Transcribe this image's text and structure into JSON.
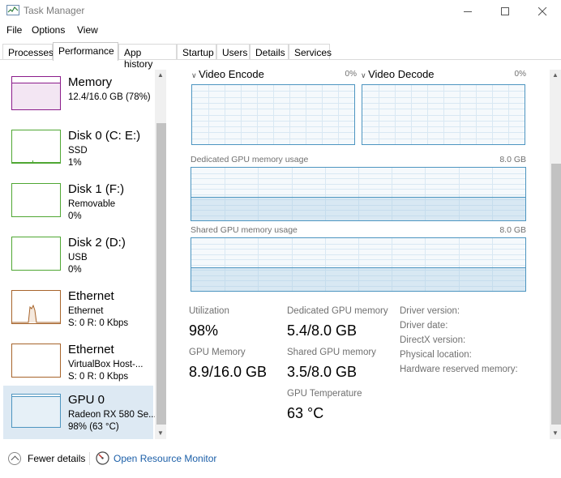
{
  "window": {
    "title": "Task Manager"
  },
  "menu": [
    "File",
    "Options",
    "View"
  ],
  "tabs": [
    "Processes",
    "Performance",
    "App history",
    "Startup",
    "Users",
    "Details",
    "Services"
  ],
  "resources": [
    {
      "name": "Memory",
      "sub1": "12.4/16.0 GB (78%)",
      "sub2": "",
      "color": "#8b1c8b"
    },
    {
      "name": "Disk 0 (C: E:)",
      "sub1": "SSD",
      "sub2": "1%",
      "color": "#4fa733"
    },
    {
      "name": "Disk 1 (F:)",
      "sub1": "Removable",
      "sub2": "0%",
      "color": "#4fa733"
    },
    {
      "name": "Disk 2 (D:)",
      "sub1": "USB",
      "sub2": "0%",
      "color": "#4fa733"
    },
    {
      "name": "Ethernet",
      "sub1": "Ethernet",
      "sub2": "S: 0 R: 0 Kbps",
      "color": "#a7642b"
    },
    {
      "name": "Ethernet",
      "sub1": "VirtualBox Host-...",
      "sub2": "S: 0 R: 0 Kbps",
      "color": "#a7642b"
    },
    {
      "name": "GPU 0",
      "sub1": "Radeon RX 580 Se...",
      "sub2": "98% (63 °C)",
      "color": "#4d95c0"
    }
  ],
  "engines": [
    {
      "name": "Video Encode",
      "pct": "0%"
    },
    {
      "name": "Video Decode",
      "pct": "0%"
    }
  ],
  "dedicated_graph": {
    "label": "Dedicated GPU memory usage",
    "max": "8.0 GB",
    "level": 0.44
  },
  "shared_graph": {
    "label": "Shared GPU memory usage",
    "max": "8.0 GB",
    "level": 0.45
  },
  "stats": {
    "utilization_label": "Utilization",
    "utilization": "98%",
    "dedicated_label": "Dedicated GPU memory",
    "dedicated": "5.4/8.0 GB",
    "gpu_memory_label": "GPU Memory",
    "gpu_memory": "8.9/16.0 GB",
    "shared_label": "Shared GPU memory",
    "shared": "3.5/8.0 GB",
    "temperature_label": "GPU Temperature",
    "temperature": "63 °C"
  },
  "info": [
    "Driver version:",
    "Driver date:",
    "DirectX version:",
    "Physical location:",
    "Hardware reserved memory:"
  ],
  "footer": {
    "fewer": "Fewer details",
    "resource_monitor": "Open Resource Monitor"
  },
  "colors": {
    "gpu_accent": "#4d95c0",
    "selection": "#dde9f3",
    "link": "#1c5fa8"
  }
}
